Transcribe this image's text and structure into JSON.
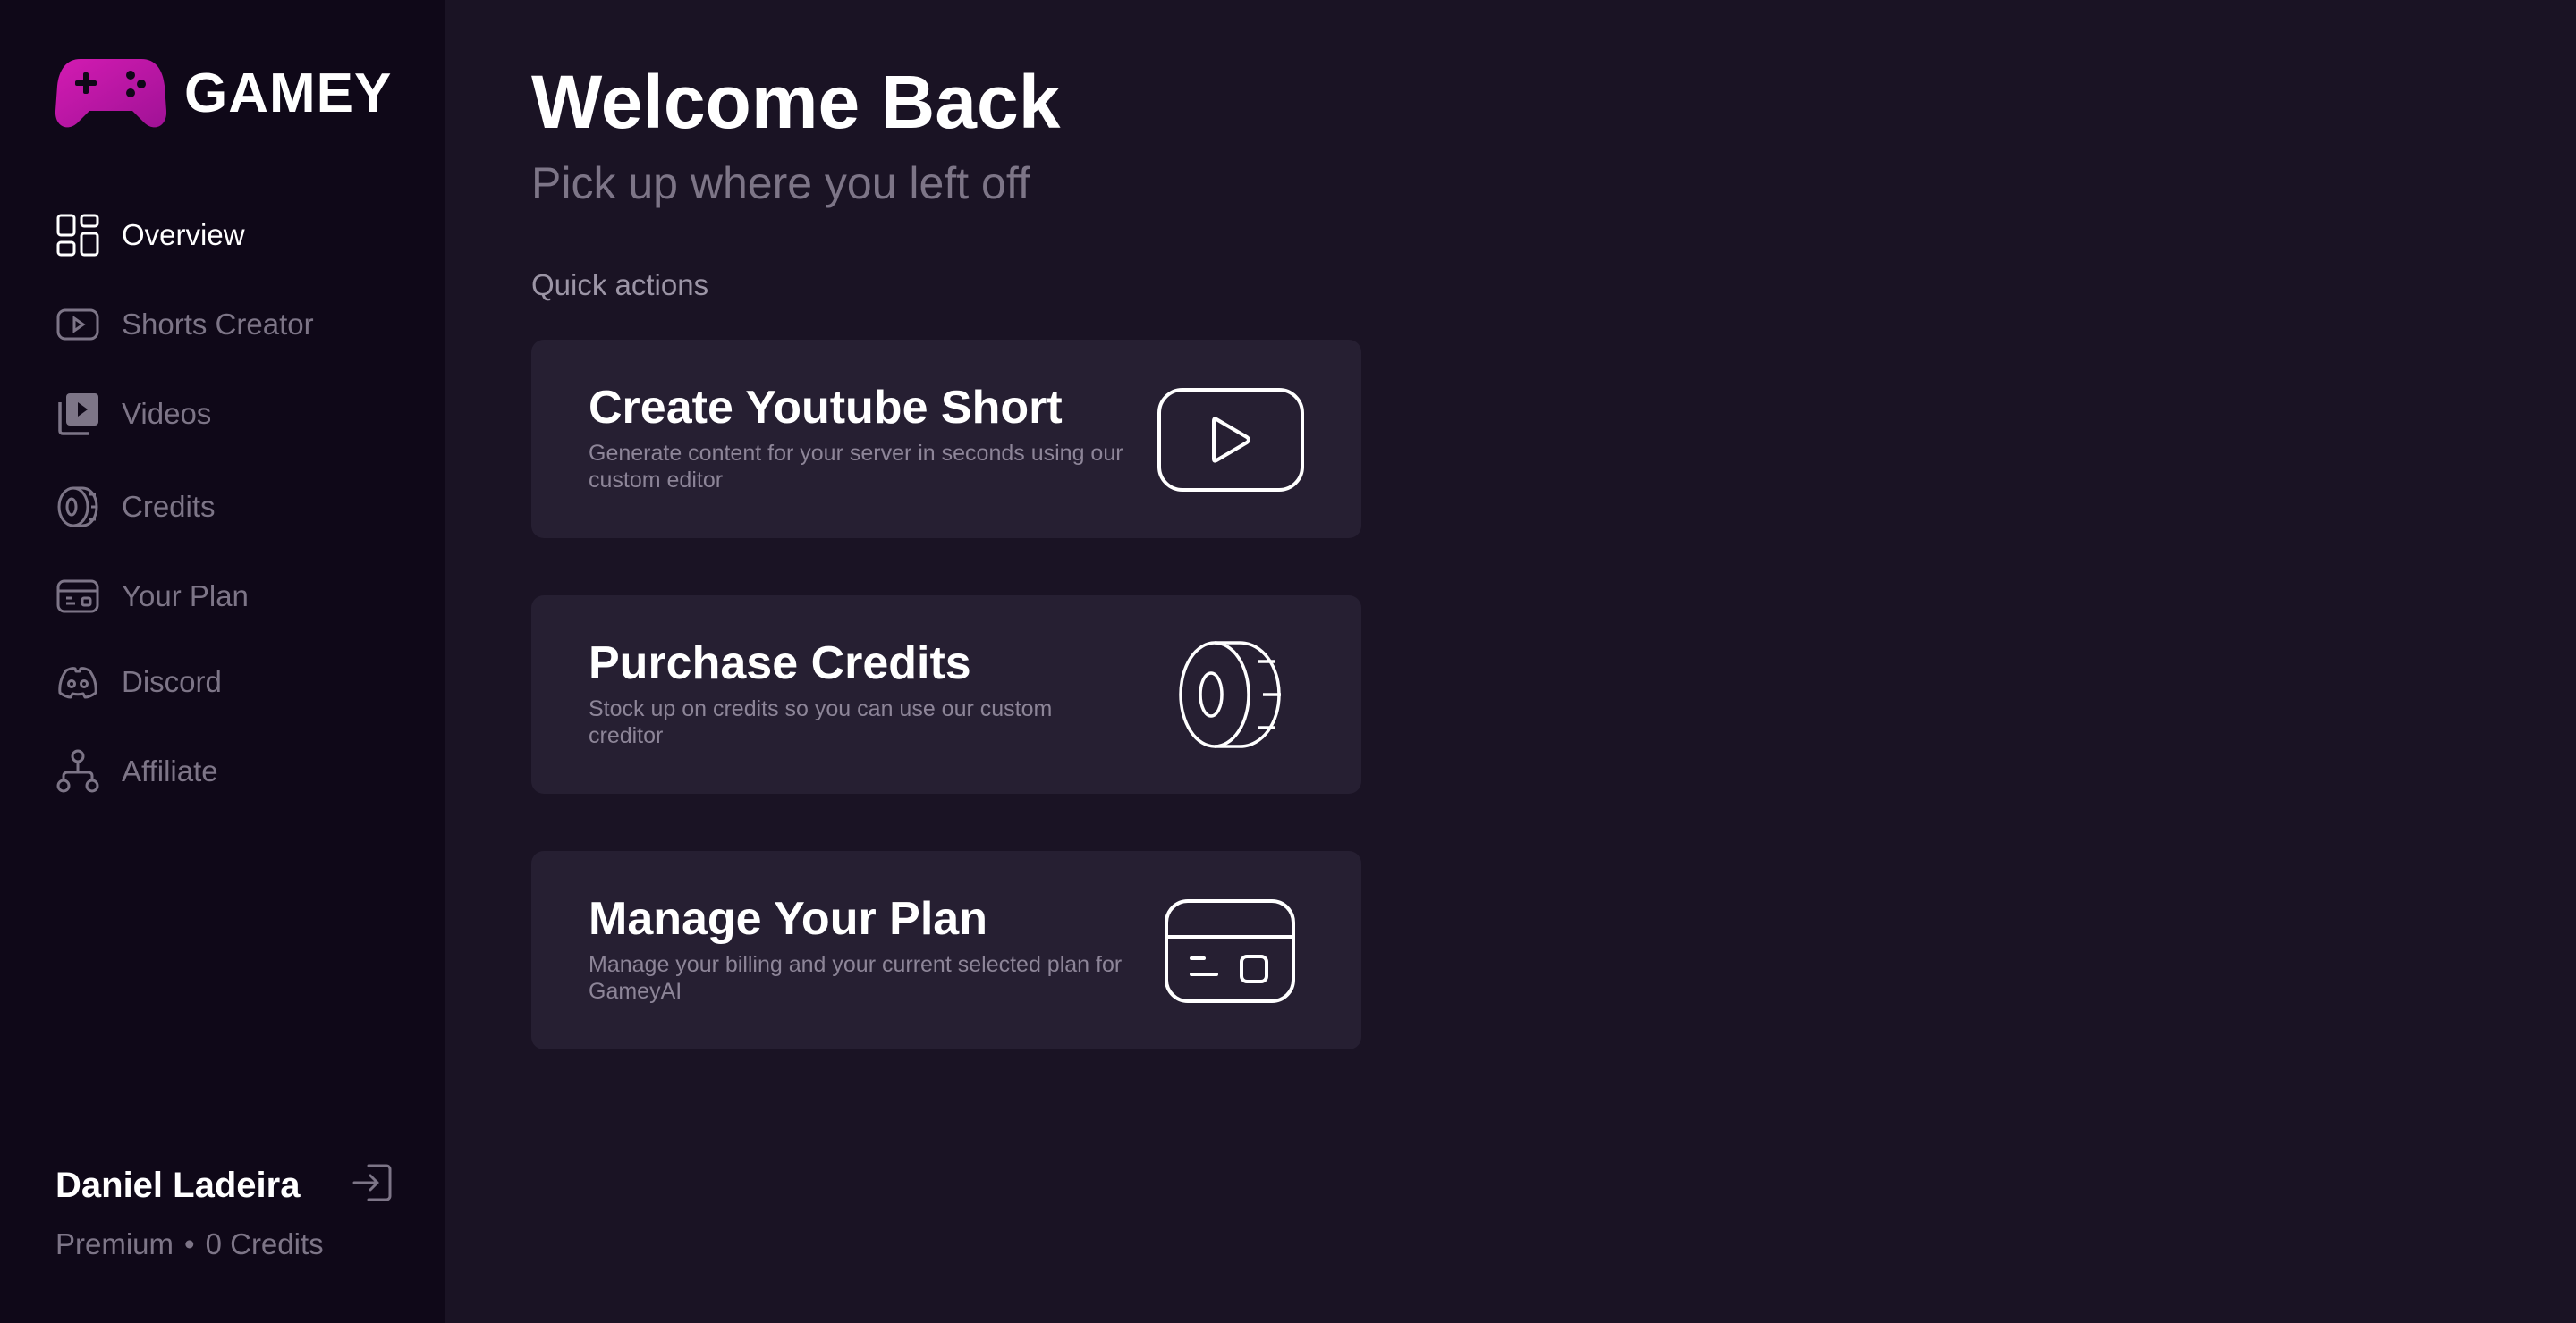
{
  "brand": {
    "name": "GAMEY",
    "logo_icon": "gamepad-icon",
    "accent": "#c318a4"
  },
  "nav": {
    "items": [
      {
        "label": "Overview",
        "icon": "dashboard-icon",
        "active": true
      },
      {
        "label": "Shorts Creator",
        "icon": "youtube-play-icon",
        "active": false
      },
      {
        "label": "Videos",
        "icon": "video-library-icon",
        "active": false
      },
      {
        "label": "Credits",
        "icon": "coin-icon",
        "active": false
      },
      {
        "label": "Your Plan",
        "icon": "card-icon",
        "active": false
      },
      {
        "label": "Discord",
        "icon": "discord-icon",
        "active": false
      },
      {
        "label": "Affiliate",
        "icon": "network-icon",
        "active": false
      }
    ]
  },
  "user": {
    "name": "Daniel Ladeira",
    "plan": "Premium",
    "separator": "•",
    "credits": "0 Credits",
    "logout_icon": "logout-icon"
  },
  "main": {
    "title": "Welcome Back",
    "subtitle": "Pick up where you left off",
    "section_label": "Quick actions",
    "cards": [
      {
        "title": "Create Youtube Short",
        "description": "Generate content for your server in seconds using our custom editor",
        "icon": "play-button-icon"
      },
      {
        "title": "Purchase Credits",
        "description": "Stock up on credits so you can use our custom creditor",
        "icon": "coin-icon"
      },
      {
        "title": "Manage Your Plan",
        "description": "Manage your billing and your current selected plan for GameyAI",
        "icon": "card-icon"
      }
    ]
  },
  "colors": {
    "sidebar_bg": "#0f0818",
    "main_bg": "#1a1324",
    "card_bg": "#261f32",
    "muted_text": "#7d7587"
  }
}
